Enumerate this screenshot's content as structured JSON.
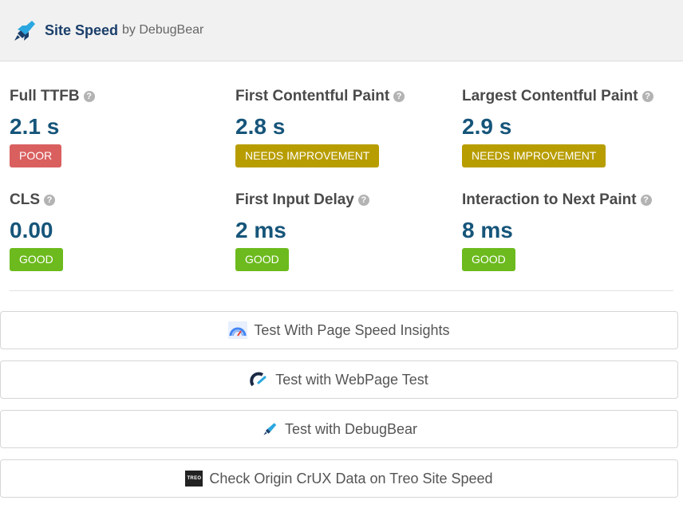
{
  "header": {
    "brand": "Site Speed",
    "by": "by DebugBear"
  },
  "metrics": [
    {
      "title": "Full TTFB",
      "value": "2.1 s",
      "status": "POOR"
    },
    {
      "title": "First Contentful Paint",
      "value": "2.8 s",
      "status": "NEEDS IMPROVEMENT"
    },
    {
      "title": "Largest Contentful Paint",
      "value": "2.9 s",
      "status": "NEEDS IMPROVEMENT"
    },
    {
      "title": "CLS",
      "value": "0.00",
      "status": "GOOD"
    },
    {
      "title": "First Input Delay",
      "value": "2 ms",
      "status": "GOOD"
    },
    {
      "title": "Interaction to Next Paint",
      "value": "8 ms",
      "status": "GOOD"
    }
  ],
  "help_glyph": "?",
  "buttons": [
    {
      "label": "Test With Page Speed Insights",
      "icon": "pagespeed-icon"
    },
    {
      "label": "Test with WebPage Test",
      "icon": "webpagetest-icon"
    },
    {
      "label": "Test with DebugBear",
      "icon": "debugbear-icon"
    },
    {
      "label": "Check Origin CrUX Data on Treo Site Speed",
      "icon": "treo-icon",
      "icon_text": "TREO"
    }
  ],
  "colors": {
    "poor": "#d9605f",
    "needs_improvement": "#b89d00",
    "good": "#6cba1d",
    "value": "#16557a",
    "brand": "#1b3f6b"
  }
}
